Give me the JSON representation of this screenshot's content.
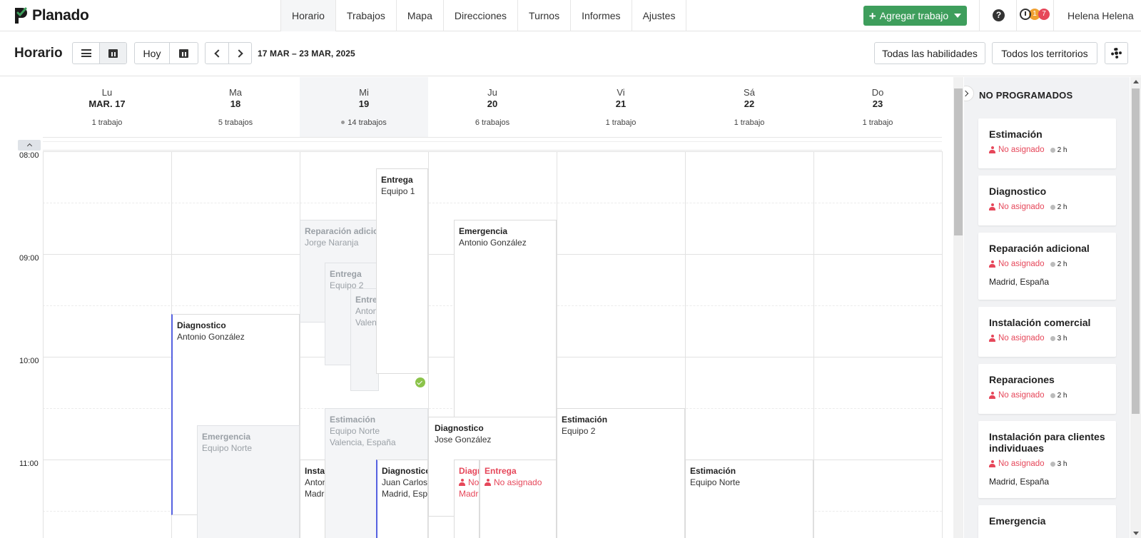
{
  "app": {
    "name": "Planado"
  },
  "nav": {
    "tabs": [
      {
        "label": "Horario",
        "active": true
      },
      {
        "label": "Trabajos"
      },
      {
        "label": "Mapa"
      },
      {
        "label": "Direcciones"
      },
      {
        "label": "Turnos"
      },
      {
        "label": "Informes"
      },
      {
        "label": "Ajustes"
      }
    ],
    "add_button": "Agregar trabajo",
    "help": "?",
    "badges": [
      "1",
      "7"
    ],
    "user": "Helena Helena"
  },
  "toolbar": {
    "title": "Horario",
    "today": "Hoy",
    "date_range": "17 MAR – 23 MAR, 2025",
    "skills_filter": "Todas las habilidades",
    "territories_filter": "Todos los territorios"
  },
  "days": [
    {
      "name": "Lu",
      "num": "MAR. 17",
      "count": "1 trabajo"
    },
    {
      "name": "Ma",
      "num": "18",
      "count": "5 trabajos"
    },
    {
      "name": "Mi",
      "num": "19",
      "count": "14 trabajos",
      "today": true
    },
    {
      "name": "Ju",
      "num": "20",
      "count": "6 trabajos"
    },
    {
      "name": "Vi",
      "num": "21",
      "count": "1 trabajo"
    },
    {
      "name": "Sá",
      "num": "22",
      "count": "1 trabajo"
    },
    {
      "name": "Do",
      "num": "23",
      "count": "1 trabajo"
    }
  ],
  "hours": [
    "08:00",
    "09:00",
    "10:00",
    "11:00"
  ],
  "jobs": [
    {
      "title": "Reparación adicional",
      "sub": "Jorge Naranja"
    },
    {
      "title": "Entrega",
      "sub": "Equipo 2"
    },
    {
      "title": "Entrega",
      "sub": "Antonio González",
      "sub2": "Valencia, España"
    },
    {
      "title": "Entrega",
      "sub": "Equipo 1"
    },
    {
      "title": "Emergencia",
      "sub": "Antonio González"
    },
    {
      "title": "Diagnostico",
      "sub": "Antonio González"
    },
    {
      "title": "Emergencia",
      "sub": "Equipo Norte"
    },
    {
      "title": "Estimación",
      "sub": "Equipo Norte",
      "sub2": "Valencia, España"
    },
    {
      "title": "Diagnostico",
      "sub": "Jose González"
    },
    {
      "title": "Instalación comercial",
      "sub": "Antonio González",
      "sub2": "Madrid, España"
    },
    {
      "title": "Diagnostico",
      "sub": "Juan Carlos",
      "sub2": "Madrid, España"
    },
    {
      "title": "Diagnostico",
      "sub": "No asignado",
      "sub2": "Madrid, España"
    },
    {
      "title": "Entrega",
      "sub": "No asignado"
    },
    {
      "title": "Estimación",
      "sub": "Equipo 2"
    },
    {
      "title": "Estimación",
      "sub": "Equipo Norte"
    }
  ],
  "unscheduled": {
    "title": "NO PROGRAMADOS",
    "cards": [
      {
        "title": "Estimación",
        "assignee": "No asignado",
        "duration": "2 h"
      },
      {
        "title": "Diagnostico",
        "assignee": "No asignado",
        "duration": "2 h"
      },
      {
        "title": "Reparación adicional",
        "assignee": "No asignado",
        "duration": "2 h",
        "location": "Madrid, España"
      },
      {
        "title": "Instalación comercial",
        "assignee": "No asignado",
        "duration": "3 h"
      },
      {
        "title": "Reparaciones",
        "assignee": "No asignado",
        "duration": "2 h"
      },
      {
        "title": "Instalación para clientes individuaes",
        "assignee": "No asignado",
        "duration": "3 h",
        "location": "Madrid, España"
      },
      {
        "title": "Emergencia"
      }
    ]
  },
  "colors": {
    "brand_green": "#3e9e5c",
    "accent_blue": "#5561e0",
    "unassigned_red": "#e6475a",
    "done_green": "#8bc34a"
  }
}
